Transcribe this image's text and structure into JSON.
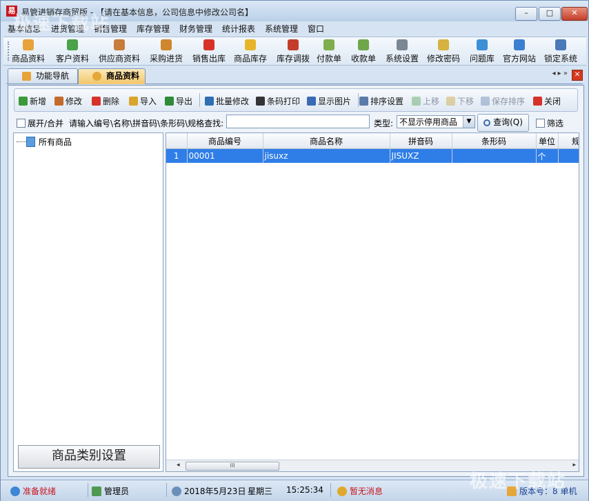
{
  "window": {
    "title": "易管进销存商贸版 - 【请在基本信息，公司信息中修改公司名】",
    "minimize": "–",
    "maximize": "□",
    "close": "✕"
  },
  "menu": [
    "基本信息",
    "进货管理",
    "销售管理",
    "库存管理",
    "财务管理",
    "统计报表",
    "系统管理",
    "窗口"
  ],
  "toolbar": [
    {
      "label": "商品资料",
      "icon": "goods-icon",
      "color": "#e8a23a"
    },
    {
      "label": "客户资料",
      "icon": "customers-icon",
      "color": "#4aa24a"
    },
    {
      "label": "供应商资料",
      "icon": "suppliers-icon",
      "color": "#c97b3a"
    },
    {
      "label": "采购进货",
      "icon": "truck-icon",
      "color": "#d0862c"
    },
    {
      "label": "销售出库",
      "icon": "cart-icon",
      "color": "#d7322a"
    },
    {
      "label": "商品库存",
      "icon": "warehouse-icon",
      "color": "#e6b52c"
    },
    {
      "label": "库存调拨",
      "icon": "transfer-icon",
      "color": "#c43c2a"
    },
    {
      "label": "付款单",
      "icon": "payment-icon",
      "color": "#7fae4c"
    },
    {
      "label": "收款单",
      "icon": "receipt-icon",
      "color": "#6ea64a"
    },
    {
      "label": "系统设置",
      "icon": "settings-icon",
      "color": "#7b8794"
    },
    {
      "label": "修改密码",
      "icon": "key-icon",
      "color": "#d6b340"
    },
    {
      "label": "问题库",
      "icon": "help-icon",
      "color": "#3d8fd6"
    },
    {
      "label": "官方网站",
      "icon": "ie-icon",
      "color": "#3b7fd0"
    },
    {
      "label": "锁定系统",
      "icon": "lock-icon",
      "color": "#4a78b8"
    }
  ],
  "tabs": [
    {
      "label": "功能导航",
      "active": false
    },
    {
      "label": "商品资料",
      "active": true
    }
  ],
  "tab_controls": "◂ ▸ »",
  "tab_close": "✕",
  "subtoolbar": [
    {
      "label": "新增",
      "color": "#3a9a3a",
      "disabled": false
    },
    {
      "label": "修改",
      "color": "#c46a2a",
      "disabled": false
    },
    {
      "label": "删除",
      "color": "#d6322a",
      "disabled": false
    },
    {
      "label": "导入",
      "color": "#d9a52c",
      "disabled": false
    },
    {
      "label": "导出",
      "color": "#2f8a3a",
      "disabled": false
    },
    {
      "label": "批量修改",
      "color": "#2f6fb3",
      "disabled": false
    },
    {
      "label": "条码打印",
      "color": "#333333",
      "disabled": false
    },
    {
      "label": "显示图片",
      "color": "#3a6ab3",
      "disabled": false
    },
    {
      "label": "排序设置",
      "color": "#5a7aa8",
      "disabled": false
    },
    {
      "label": "上移",
      "color": "#4a9a4a",
      "disabled": true
    },
    {
      "label": "下移",
      "color": "#c99a2a",
      "disabled": true
    },
    {
      "label": "保存排序",
      "color": "#5a7aa8",
      "disabled": true
    },
    {
      "label": "关闭",
      "color": "#d6322a",
      "disabled": false
    }
  ],
  "search": {
    "expand_label": "展开/合并",
    "prompt": "请输入编号\\名称\\拼音码\\条形码\\规格查找:",
    "value": "",
    "type_label": "类型:",
    "type_value": "不显示停用商品",
    "query_button": "查询(Q)",
    "filter_label": "筛选"
  },
  "tree": {
    "root": "所有商品",
    "category_button": "商品类别设置"
  },
  "grid": {
    "columns": [
      "",
      "商品编号",
      "商品名称",
      "拼音码",
      "条形码",
      "单位",
      "规"
    ],
    "rows": [
      [
        "1",
        "00001",
        "jisuxz",
        "JISUXZ",
        "",
        "个",
        ""
      ]
    ],
    "scroll_thumb": "III"
  },
  "status": {
    "ready": "准备就绪",
    "user": "管理员",
    "date": "2018年5月23日",
    "weekday": "星期三",
    "time": "15:25:34",
    "message": "暂无消息",
    "version": "版本号：8 单机"
  },
  "watermark": "极速下载站"
}
